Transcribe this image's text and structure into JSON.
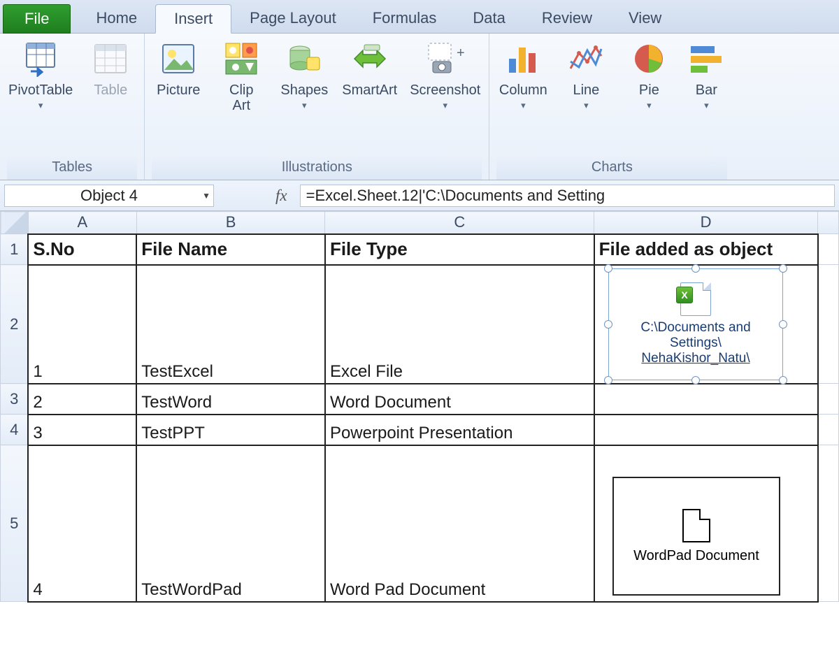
{
  "tabs": {
    "file": "File",
    "home": "Home",
    "insert": "Insert",
    "pagelayout": "Page Layout",
    "formulas": "Formulas",
    "data": "Data",
    "review": "Review",
    "view": "View",
    "active": "insert"
  },
  "ribbon": {
    "groups": {
      "tables": {
        "label": "Tables",
        "buttons": {
          "pivottable": "PivotTable",
          "table": "Table"
        }
      },
      "illustrations": {
        "label": "Illustrations",
        "buttons": {
          "picture": "Picture",
          "clipart": "Clip\nArt",
          "shapes": "Shapes",
          "smartart": "SmartArt",
          "screenshot": "Screenshot"
        }
      },
      "charts": {
        "label": "Charts",
        "buttons": {
          "column": "Column",
          "line": "Line",
          "pie": "Pie",
          "bar": "Bar"
        }
      }
    }
  },
  "formula_bar": {
    "name_box": "Object 4",
    "fx_label": "fx",
    "formula": "=Excel.Sheet.12|'C:\\Documents and Setting"
  },
  "grid": {
    "columns": [
      "A",
      "B",
      "C",
      "D"
    ],
    "row_labels": [
      "1",
      "2",
      "3",
      "4",
      "5"
    ],
    "headers": {
      "A": "S.No",
      "B": "File Name",
      "C": "File Type",
      "D": "File added as object"
    },
    "rows": [
      {
        "A": "1",
        "B": "TestExcel",
        "C": "Excel File",
        "D": ""
      },
      {
        "A": "2",
        "B": "TestWord",
        "C": "Word Document",
        "D": ""
      },
      {
        "A": "3",
        "B": "TestPPT",
        "C": "Powerpoint Presentation",
        "D": ""
      },
      {
        "A": "4",
        "B": "TestWordPad",
        "C": "Word Pad Document",
        "D": ""
      }
    ]
  },
  "objects": {
    "selected_excel": {
      "caption_line1": "C:\\Documents and",
      "caption_line2": "Settings\\",
      "caption_line3": "NehaKishor_Natu\\",
      "xl_glyph": "X"
    },
    "wordpad": {
      "caption": "WordPad Document"
    }
  }
}
